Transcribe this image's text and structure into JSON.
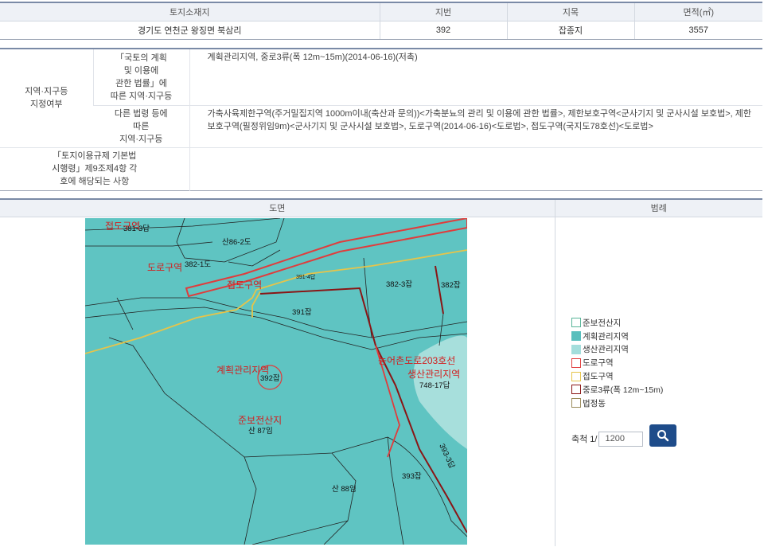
{
  "land_table": {
    "headers": [
      "토지소재지",
      "지번",
      "지목",
      "면적(㎡)"
    ],
    "row": [
      "경기도 연천군 왕징면 북삼리",
      "392",
      "잡종지",
      "3557"
    ]
  },
  "zoning": {
    "section_label": "지역·지구등\n지정여부",
    "national_label": "「국토의 계획\n및 이용에\n관한 법률」에\n따른 지역·지구등",
    "national_value": "계획관리지역, 중로3류(폭 12m~15m)(2014-06-16)(저촉)",
    "other_label": "다른 법령 등에\n따른\n지역·지구등",
    "other_value": "가축사육제한구역(주거밀집지역 1000m이내(축산과 문의))<가축분뇨의 관리 및 이용에 관한 법률>, 제한보호구역<군사기지 및 군사시설 보호법>, 제한보호구역(필정위임9m)<군사기지 및 군사시설 보호법>, 도로구역(2014-06-16)<도로법>, 접도구역(국지도78호선)<도로법>",
    "regulation_label": "「토지이용규제 기본법\n시행령」제9조제4항 각\n호에 해당되는 사항",
    "regulation_value": ""
  },
  "bottom": {
    "map_header": "도면",
    "legend_header": "범례"
  },
  "map_labels": {
    "parcel_381_3": "381-3답",
    "parcel_san86_2": "산86-2도",
    "parcel_382_1": "382-1도",
    "parcel_391_4": "391-4답",
    "parcel_382_3": "382-3잡",
    "parcel_382": "382잡",
    "parcel_391": "391잡",
    "parcel_392": "392잡",
    "parcel_748_17": "748-17답",
    "parcel_san87": "산 87임",
    "parcel_393": "393잡",
    "parcel_393_3": "393-3답",
    "parcel_san88": "산 88임",
    "zone_road_a": "도로구역",
    "zone_road_b": "도로구역",
    "zone_access_a": "접도구역",
    "zone_access_b": "접도구역",
    "zone_planned": "계획관리지역",
    "zone_road203": "농어촌도로203호선",
    "zone_production": "생산관리지역",
    "zone_semi_forest": "준보전산지"
  },
  "legend": {
    "items": [
      {
        "label": "준보전산지",
        "fill": "#ffffff",
        "border": "#58b598"
      },
      {
        "label": "계획관리지역",
        "fill": "#58bfbd",
        "border": "#58bfbd"
      },
      {
        "label": "생산관리지역",
        "fill": "#a4dedc",
        "border": "#a4dedc"
      },
      {
        "label": "도로구역",
        "fill": "#ffffff",
        "border": "#e03c3c"
      },
      {
        "label": "접도구역",
        "fill": "#ffffff",
        "border": "#e6c44a"
      },
      {
        "label": "중로3류(폭 12m~15m)",
        "fill": "#ffffff",
        "border": "#8a1515"
      },
      {
        "label": "법정동",
        "fill": "#ffffff",
        "border": "#9a8a5a"
      }
    ]
  },
  "scale": {
    "label": "축척 1/",
    "value": "1200",
    "search_icon": "search-icon"
  }
}
